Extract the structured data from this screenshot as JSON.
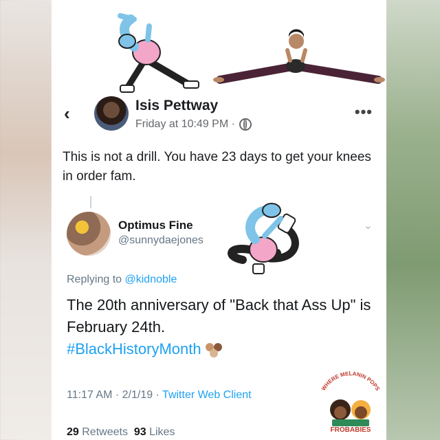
{
  "facebook": {
    "name": "Isis Pettway",
    "timestamp": "Friday at 10:49 PM ·",
    "post_text": "This is not a drill. You have 23 days to get your knees in order fam.",
    "back_icon": "chevron-left-icon",
    "more_icon": "more-dots-icon"
  },
  "twitter": {
    "name": "Optimus Fine",
    "handle": "@sunnydaejones",
    "replying_label": "Replying to",
    "replying_handle": "@kidnoble",
    "tweet_text": "The 20th anniversary of \"Back that Ass Up\" is February 24th.",
    "hashtag": "#BlackHistoryMonth",
    "time": "11:17 AM · 2/1/19 ·",
    "client": "Twitter Web Client",
    "retweets_count": "29",
    "retweets_label": "Retweets",
    "likes_count": "93",
    "likes_label": "Likes",
    "accent_color": "#1da1f2"
  },
  "logo": {
    "top_text": "WHERE MELANIN POPS",
    "side_text": "FROBABIES",
    "bottom_text": "FROBABIES"
  }
}
